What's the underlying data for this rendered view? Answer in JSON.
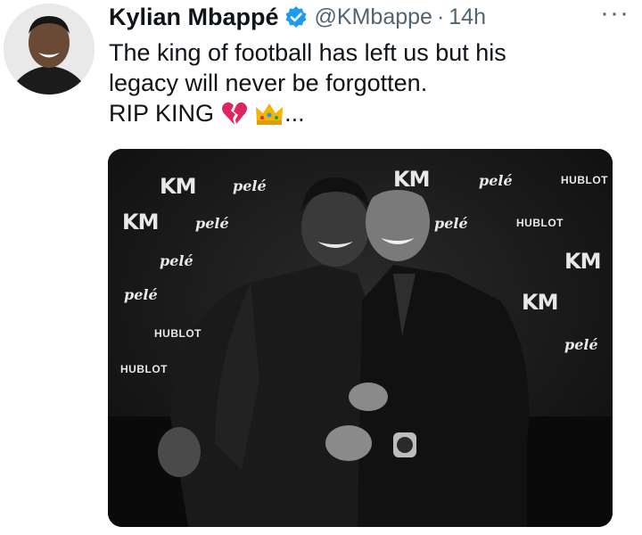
{
  "tweet": {
    "author_name": "Kylian Mbappé",
    "handle": "@KMbappe",
    "separator": "·",
    "time": "14h",
    "more_label": "···",
    "text_line1": "The king of football has left us but his",
    "text_line2": "legacy will never be forgotten.",
    "text_line3": "RIP KING",
    "emoji_1": "broken-heart",
    "emoji_2": "crown",
    "ellipsis": "..."
  },
  "media": {
    "backdrop_logos": [
      "KM",
      "pelé",
      "HUBLOT"
    ],
    "photo_style": "black-and-white"
  },
  "colors": {
    "text": "#0f1419",
    "secondary": "#536471",
    "verified": "#1d9bf0",
    "broken_heart": "#e0245e",
    "crown": "#f4b400"
  }
}
